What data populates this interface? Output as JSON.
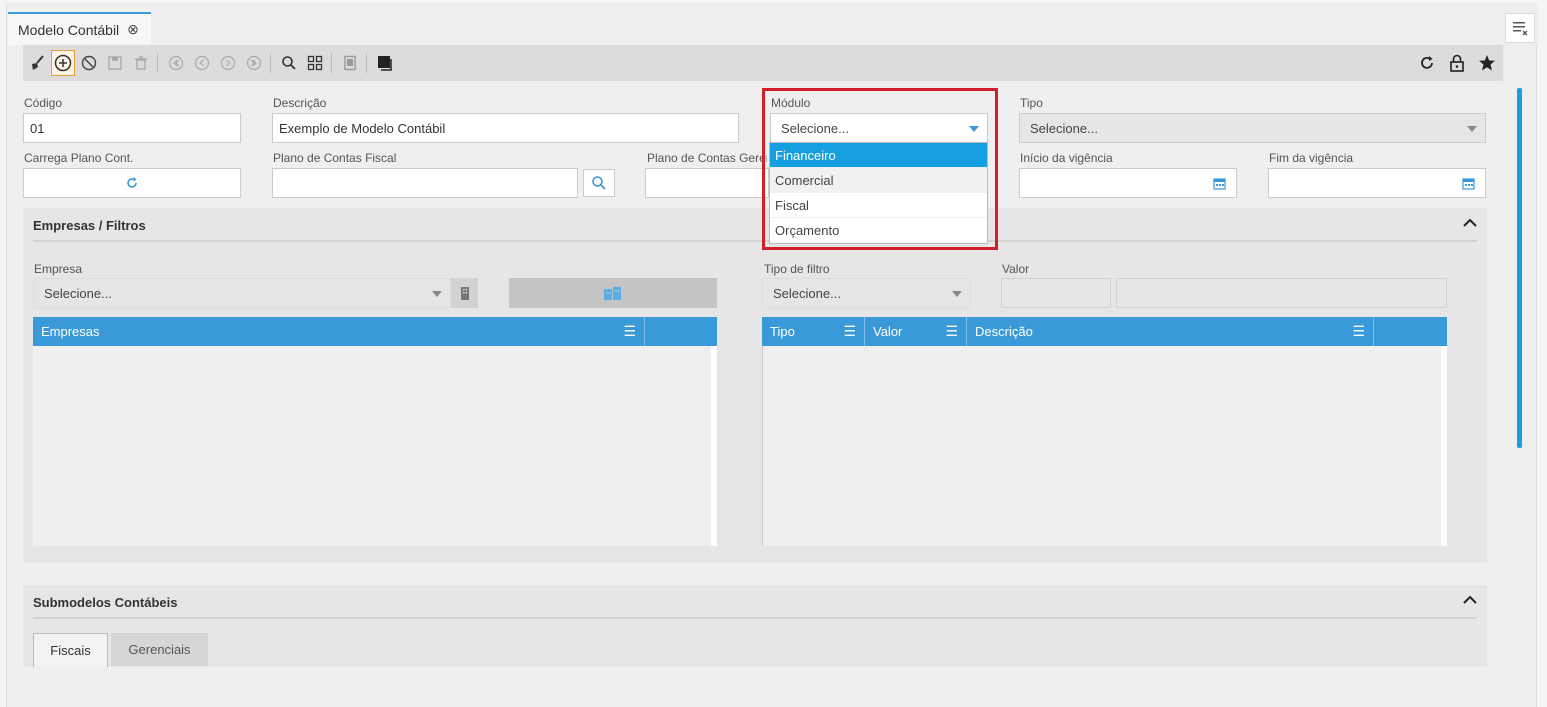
{
  "tab": {
    "title": "Modelo Contábil",
    "close_icon": "⊗"
  },
  "toolbar": {
    "left_icons": [
      "broom-icon",
      "add-circle-icon",
      "cancel-icon",
      "save-icon",
      "trash-icon",
      "first-icon",
      "prev-icon",
      "next-icon",
      "last-icon",
      "search-icon",
      "grid-icon",
      "document-icon",
      "copy-icon"
    ],
    "right_icons": [
      "refresh-icon",
      "lock-icon",
      "star-icon"
    ]
  },
  "form": {
    "codigo": {
      "label": "Código",
      "value": "01"
    },
    "descricao": {
      "label": "Descrição",
      "value": "Exemplo de Modelo Contábil"
    },
    "modulo": {
      "label": "Módulo",
      "value": "Selecione..."
    },
    "tipo": {
      "label": "Tipo",
      "value": "Selecione..."
    },
    "carrega_plano": {
      "label": "Carrega Plano Cont."
    },
    "plano_fiscal": {
      "label": "Plano de Contas Fiscal",
      "value": ""
    },
    "plano_gerencial": {
      "label": "Plano de Contas Gerencial",
      "value": ""
    },
    "inicio_vigencia": {
      "label": "Início da vigência",
      "value": ""
    },
    "fim_vigencia": {
      "label": "Fim da vigência",
      "value": ""
    }
  },
  "modulo_dropdown": {
    "options": [
      "Financeiro",
      "Comercial",
      "Fiscal",
      "Orçamento"
    ],
    "selected_index": 0,
    "hover_index": 1
  },
  "empresas_panel": {
    "title": "Empresas / Filtros",
    "empresa_label": "Empresa",
    "empresa_value": "Selecione...",
    "tipo_filtro_label": "Tipo de filtro",
    "tipo_filtro_value": "Selecione...",
    "valor_label": "Valor",
    "empresas_grid": {
      "columns": [
        "Empresas"
      ]
    },
    "filtros_grid": {
      "columns": [
        "Tipo",
        "Valor",
        "Descrição"
      ]
    }
  },
  "submodelos_panel": {
    "title": "Submodelos Contábeis",
    "tabs": [
      "Fiscais",
      "Gerenciais"
    ]
  },
  "colors": {
    "accent": "#3a9ad9",
    "selected": "#14a0e0",
    "highlight": "#d0202a"
  }
}
